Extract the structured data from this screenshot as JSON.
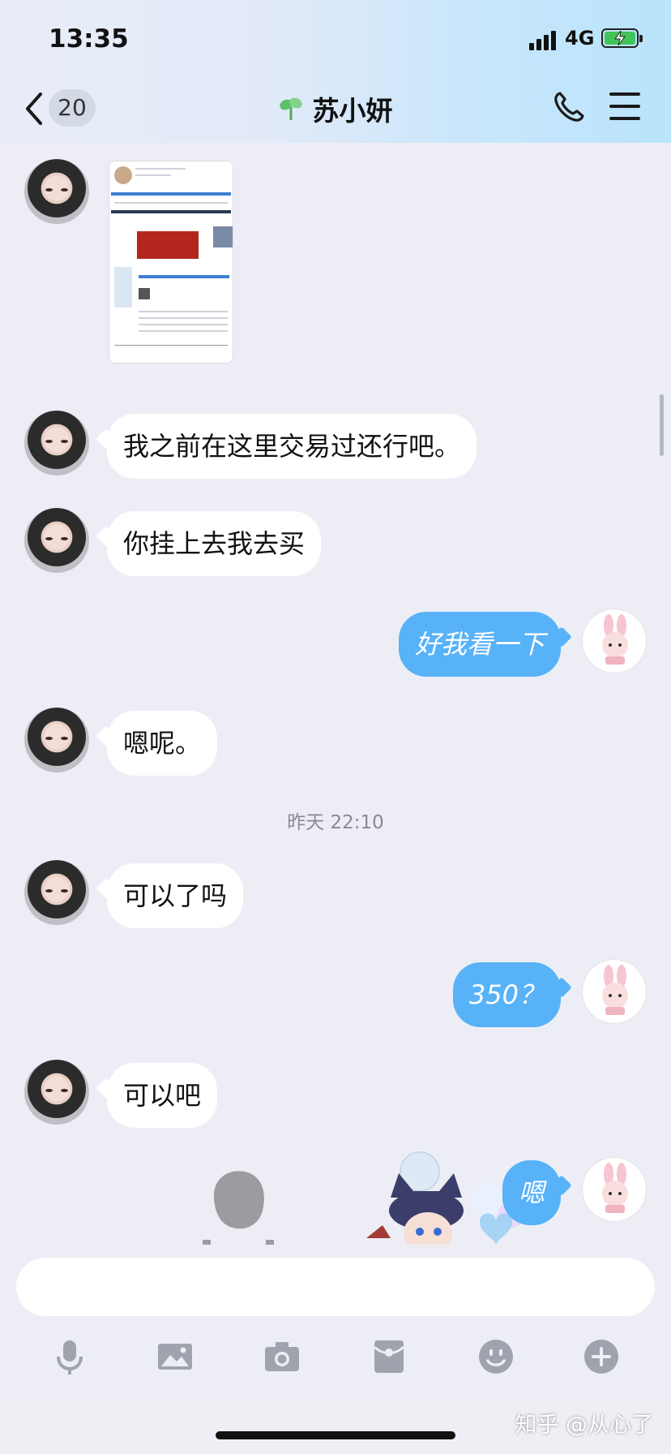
{
  "status_bar": {
    "time": "13:35",
    "network": "4G"
  },
  "header": {
    "unread_count": "20",
    "contact_name": "苏小妍"
  },
  "messages": [
    {
      "side": "left",
      "type": "image"
    },
    {
      "side": "left",
      "type": "text",
      "text": "我之前在这里交易过还行吧。"
    },
    {
      "side": "left",
      "type": "text",
      "text": "你挂上去我去买"
    },
    {
      "side": "right",
      "type": "text",
      "text": "好我看一下"
    },
    {
      "side": "left",
      "type": "text",
      "text": "嗯呢。"
    },
    {
      "side": "left",
      "type": "text",
      "text": "可以了吗"
    },
    {
      "side": "right",
      "type": "text",
      "text": "350？"
    },
    {
      "side": "left",
      "type": "text",
      "text": "可以吧"
    },
    {
      "side": "right",
      "type": "text",
      "text": "嗯"
    }
  ],
  "timestamp": "昨天 22:10",
  "input": {
    "placeholder": ""
  },
  "toolbar": [
    "microphone-icon",
    "image-icon",
    "camera-icon",
    "red-packet-icon",
    "emoji-icon",
    "plus-icon"
  ],
  "watermark": "知乎 @从心了",
  "colors": {
    "sent_bubble": "#57b2f8",
    "received_bubble": "#ffffff",
    "background": "#edeef5"
  }
}
